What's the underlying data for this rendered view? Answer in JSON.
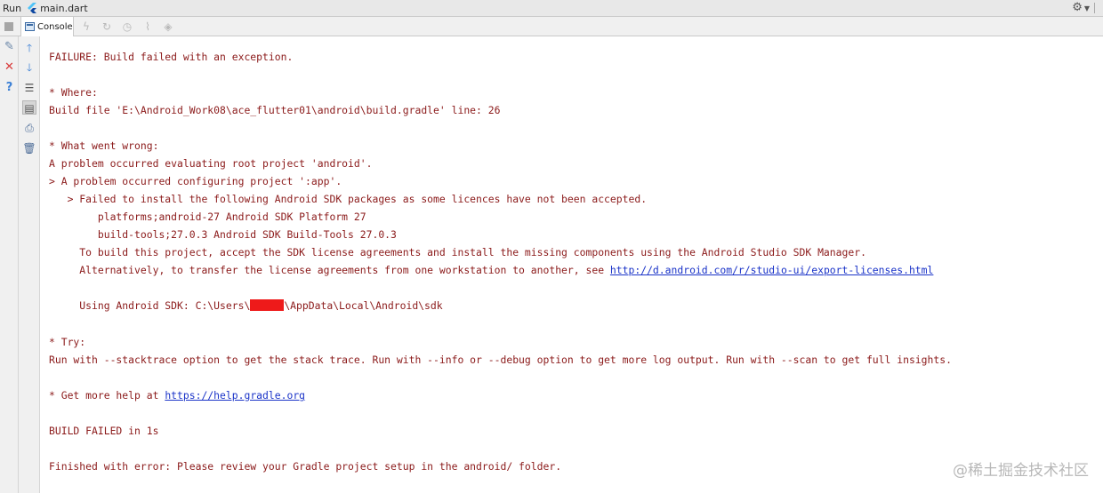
{
  "titlebar": {
    "run_label": "Run",
    "file_name": "main.dart"
  },
  "toolbar": {
    "console_tab": "Console"
  },
  "icons": {
    "left": [
      "stop-icon",
      "pin-icon",
      "close-icon",
      "help-icon"
    ],
    "second": [
      "scroll-up-icon",
      "scroll-down-icon",
      "soft-wrap-icon",
      "scroll-to-end-icon",
      "print-icon",
      "clear-all-icon"
    ]
  },
  "console": {
    "lines": [
      "FAILURE: Build failed with an exception.",
      "* Where:",
      "Build file 'E:\\Android_Work08\\ace_flutter01\\android\\build.gradle' line: 26",
      "* What went wrong:",
      "A problem occurred evaluating root project 'android'.",
      "> A problem occurred configuring project ':app'.",
      "   > Failed to install the following Android SDK packages as some licences have not been accepted.",
      "        platforms;android-27 Android SDK Platform 27",
      "        build-tools;27.0.3 Android SDK Build-Tools 27.0.3",
      "     To build this project, accept the SDK license agreements and install the missing components using the Android Studio SDK Manager.",
      "     Alternatively, to transfer the license agreements from one workstation to another, see ",
      "http://d.android.com/r/studio-ui/export-licenses.html",
      "     Using Android SDK: C:\\Users\\",
      "\\AppData\\Local\\Android\\sdk",
      "* Try:",
      "Run with --stacktrace option to get the stack trace. Run with --info or --debug option to get more log output. Run with --scan to get full insights.",
      "* Get more help at ",
      "https://help.gradle.org",
      "BUILD FAILED in 1s",
      "Finished with error: Please review your Gradle project setup in the android/ folder."
    ]
  },
  "watermark": "@稀土掘金技术社区",
  "colors": {
    "error_text": "#8b1a1a",
    "link": "#1a33c8",
    "redaction": "#ee1a1a"
  }
}
